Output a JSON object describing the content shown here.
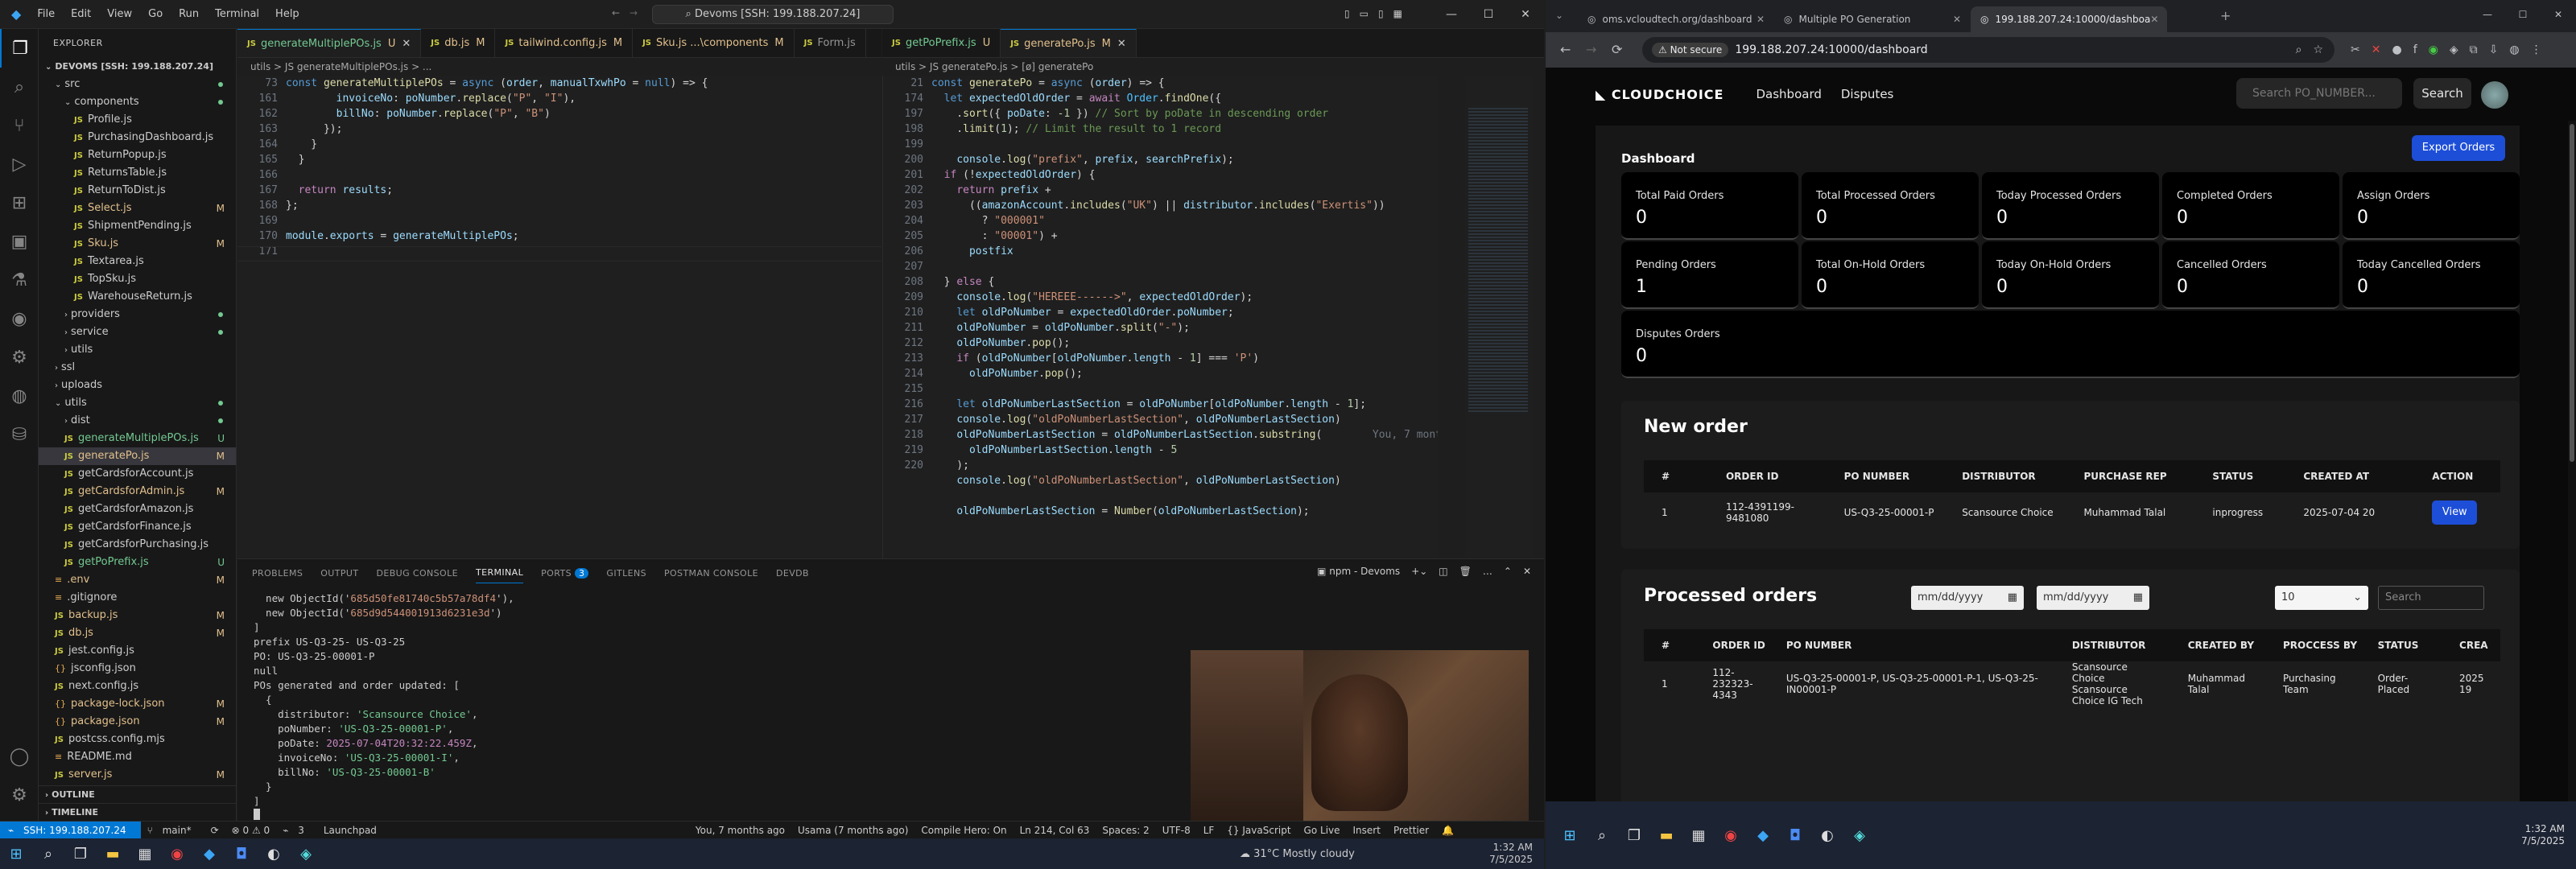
{
  "vscode": {
    "menu": [
      "File",
      "Edit",
      "View",
      "Go",
      "Run",
      "Terminal",
      "Help"
    ],
    "command_center": "Devoms [SSH: 199.188.207.24]",
    "explorer_label": "EXPLORER",
    "root": "DEVOMS [SSH: 199.188.207.24]",
    "tree": [
      {
        "label": "src",
        "kind": "folder",
        "indent": 1,
        "badge": "dot"
      },
      {
        "label": "components",
        "kind": "folder",
        "indent": 2,
        "badge": "dot"
      },
      {
        "label": "Profile.js",
        "kind": "js",
        "indent": 3,
        "badge": ""
      },
      {
        "label": "PurchasingDashboard.js",
        "kind": "js",
        "indent": 3,
        "badge": ""
      },
      {
        "label": "ReturnPopup.js",
        "kind": "js",
        "indent": 3,
        "badge": ""
      },
      {
        "label": "ReturnsTable.js",
        "kind": "js",
        "indent": 3,
        "badge": ""
      },
      {
        "label": "ReturnToDist.js",
        "kind": "js",
        "indent": 3,
        "badge": ""
      },
      {
        "label": "Select.js",
        "kind": "js",
        "indent": 3,
        "badge": "M"
      },
      {
        "label": "ShipmentPending.js",
        "kind": "js",
        "indent": 3,
        "badge": ""
      },
      {
        "label": "Sku.js",
        "kind": "js",
        "indent": 3,
        "badge": "M"
      },
      {
        "label": "Textarea.js",
        "kind": "js",
        "indent": 3,
        "badge": ""
      },
      {
        "label": "TopSku.js",
        "kind": "js",
        "indent": 3,
        "badge": ""
      },
      {
        "label": "WarehouseReturn.js",
        "kind": "js",
        "indent": 3,
        "badge": ""
      },
      {
        "label": "providers",
        "kind": "folderc",
        "indent": 2,
        "badge": "dot"
      },
      {
        "label": "service",
        "kind": "folderc",
        "indent": 2,
        "badge": "dot"
      },
      {
        "label": "utils",
        "kind": "folderc",
        "indent": 2,
        "badge": ""
      },
      {
        "label": "ssl",
        "kind": "folderc",
        "indent": 1,
        "badge": ""
      },
      {
        "label": "uploads",
        "kind": "folderc",
        "indent": 1,
        "badge": ""
      },
      {
        "label": "utils",
        "kind": "folder",
        "indent": 1,
        "badge": "dot"
      },
      {
        "label": "dist",
        "kind": "folderc",
        "indent": 2,
        "badge": "dot"
      },
      {
        "label": "generateMultiplePOs.js",
        "kind": "js",
        "indent": 2,
        "badge": "U"
      },
      {
        "label": "generatePo.js",
        "kind": "js",
        "indent": 2,
        "badge": "M",
        "selected": true
      },
      {
        "label": "getCardsforAccount.js",
        "kind": "js",
        "indent": 2,
        "badge": ""
      },
      {
        "label": "getCardsforAdmin.js",
        "kind": "js",
        "indent": 2,
        "badge": "M"
      },
      {
        "label": "getCardsforAmazon.js",
        "kind": "js",
        "indent": 2,
        "badge": ""
      },
      {
        "label": "getCardsforFinance.js",
        "kind": "js",
        "indent": 2,
        "badge": ""
      },
      {
        "label": "getCardsforPurchasing.js",
        "kind": "js",
        "indent": 2,
        "badge": ""
      },
      {
        "label": "getPoPrefix.js",
        "kind": "js",
        "indent": 2,
        "badge": "U"
      },
      {
        "label": ".env",
        "kind": "file",
        "indent": 1,
        "badge": "M"
      },
      {
        "label": ".gitignore",
        "kind": "file",
        "indent": 1,
        "badge": ""
      },
      {
        "label": "backup.js",
        "kind": "js",
        "indent": 1,
        "badge": "M"
      },
      {
        "label": "db.js",
        "kind": "js",
        "indent": 1,
        "badge": "M"
      },
      {
        "label": "jest.config.js",
        "kind": "js",
        "indent": 1,
        "badge": ""
      },
      {
        "label": "jsconfig.json",
        "kind": "json",
        "indent": 1,
        "badge": ""
      },
      {
        "label": "next.config.js",
        "kind": "js",
        "indent": 1,
        "badge": ""
      },
      {
        "label": "package-lock.json",
        "kind": "json",
        "indent": 1,
        "badge": "M"
      },
      {
        "label": "package.json",
        "kind": "json",
        "indent": 1,
        "badge": "M"
      },
      {
        "label": "postcss.config.mjs",
        "kind": "js",
        "indent": 1,
        "badge": ""
      },
      {
        "label": "README.md",
        "kind": "file",
        "indent": 1,
        "badge": ""
      },
      {
        "label": "server.js",
        "kind": "js",
        "indent": 1,
        "badge": "M"
      }
    ],
    "outline": "OUTLINE",
    "timeline": "TIMELINE",
    "tabs_left": [
      {
        "label": "generateMultiplePOs.js",
        "mark": "U",
        "active": true
      },
      {
        "label": "db.js",
        "mark": "M"
      },
      {
        "label": "tailwind.config.js",
        "mark": "M"
      },
      {
        "label": "Sku.js ...\\components",
        "mark": "M"
      },
      {
        "label": "Form.js",
        "mark": ""
      }
    ],
    "tabs_right": [
      {
        "label": "getPoPrefix.js",
        "mark": "U"
      },
      {
        "label": "generatePo.js",
        "mark": "M",
        "active": true
      }
    ],
    "breadcrumb_left": "utils > JS generateMultiplePOs.js > ...",
    "breadcrumb_right": "utils > JS generatePo.js > [ø] generatePo",
    "left_lines": [
      "73",
      "161",
      "162",
      "163",
      "164",
      "165",
      "166",
      "167",
      "168",
      "169",
      "170",
      "171"
    ],
    "left_code": [
      "<span class='kw'>const</span> <span class='fn'>generateMultiplePOs</span> = <span class='kw'>async</span> (<span class='vr'>order</span>, <span class='vr'>manualTxwhPo</span> = <span class='kw'>null</span>) => {",
      "        <span class='vr'>invoiceNo</span>: <span class='vr'>poNumber</span>.<span class='fn'>replace</span>(<span class='st'>\"P\"</span>, <span class='st'>\"I\"</span>),",
      "        <span class='vr'>billNo</span>: <span class='vr'>poNumber</span>.<span class='fn'>replace</span>(<span class='st'>\"P\"</span>, <span class='st'>\"B\"</span>)",
      "      });",
      "    }",
      "  }",
      "",
      "  <span class='kp'>return</span> <span class='vr'>results</span>;",
      "};",
      "",
      "<span class='vr'>module</span>.<span class='vr'>exports</span> = <span class='vr'>generateMultiplePOs</span>;",
      ""
    ],
    "right_lines": [
      "21",
      "174",
      "",
      "197",
      "198",
      "199",
      "200",
      "201",
      "202",
      "203",
      "204",
      "205",
      "206",
      "207",
      "208",
      "209",
      "210",
      "211",
      "212",
      "213",
      "214",
      "215",
      "216",
      "217",
      "218",
      "219",
      "220"
    ],
    "right_code": [
      "<span class='kw'>const</span> <span class='fn'>generatePo</span> = <span class='kw'>async</span> (<span class='vr'>order</span>) => {",
      "  <span class='kw'>let</span> <span class='vr'>expectedOldOrder</span> = <span class='kp'>await</span> <span class='ct'>Order</span>.<span class='fn'>findOne</span>({",
      "    .<span class='fn'>sort</span>({ <span class='vr'>poDate</span>: <span class='nm'>-1</span> }) <span class='cm'>// Sort by poDate in descending order</span>",
      "    .<span class='fn'>limit</span>(<span class='nm'>1</span>); <span class='cm'>// Limit the result to 1 record</span>",
      "",
      "    <span class='vr'>console</span>.<span class='fn'>log</span>(<span class='st'>\"prefix\"</span>, <span class='vr'>prefix</span>, <span class='vr'>searchPrefix</span>);",
      "  <span class='kp'>if</span> (!<span class='vr'>expectedOldOrder</span>) {",
      "    <span class='kp'>return</span> <span class='vr'>prefix</span> +",
      "      ((<span class='vr'>amazonAccount</span>.<span class='fn'>includes</span>(<span class='st'>\"UK\"</span>) || <span class='vr'>distributor</span>.<span class='fn'>includes</span>(<span class='st'>\"Exertis\"</span>))",
      "        ? <span class='st'>\"000001\"</span>",
      "        : <span class='st'>\"00001\"</span>) +",
      "      <span class='vr'>postfix</span>",
      "",
      "  } <span class='kp'>else</span> {",
      "    <span class='vr'>console</span>.<span class='fn'>log</span>(<span class='st'>\"HEREEE------>\"</span>, <span class='vr'>expectedOldOrder</span>);",
      "    <span class='kw'>let</span> <span class='vr'>oldPoNumber</span> = <span class='vr'>expectedOldOrder</span>.<span class='vr'>poNumber</span>;",
      "    <span class='vr'>oldPoNumber</span> = <span class='vr'>oldPoNumber</span>.<span class='fn'>split</span>(<span class='st'>\"-\"</span>);",
      "    <span class='vr'>oldPoNumber</span>.<span class='fn'>pop</span>();",
      "    <span class='kp'>if</span> (<span class='vr'>oldPoNumber</span>[<span class='vr'>oldPoNumber</span>.<span class='vr'>length</span> - <span class='nm'>1</span>] === <span class='st'>'P'</span>)",
      "      <span class='vr'>oldPoNumber</span>.<span class='fn'>pop</span>();",
      "",
      "    <span class='kw'>let</span> <span class='vr'>oldPoNumberLastSection</span> = <span class='vr'>oldPoNumber</span>[<span class='vr'>oldPoNumber</span>.<span class='vr'>length</span> - <span class='nm'>1</span>];",
      "    <span class='vr'>console</span>.<span class='fn'>log</span>(<span class='st'>\"oldPoNumberLastSection\"</span>, <span class='vr'>oldPoNumberLastSection</span>)",
      "    <span class='vr'>oldPoNumberLastSection</span> = <span class='vr'>oldPoNumberLastSection</span>.<span class='fn'>substring</span>(        <span style='color:#6e7681'>You, 7 months</span>",
      "      <span class='vr'>oldPoNumberLastSection</span>.<span class='vr'>length</span> - <span class='nm'>5</span>",
      "    );",
      "    <span class='vr'>console</span>.<span class='fn'>log</span>(<span class='st'>\"oldPoNumberLastSection\"</span>, <span class='vr'>oldPoNumberLastSection</span>)",
      "",
      "    <span class='vr'>oldPoNumberLastSection</span> = <span class='fn'>Number</span>(<span class='vr'>oldPoNumberLastSection</span>);"
    ],
    "panel_tabs": [
      "PROBLEMS",
      "OUTPUT",
      "DEBUG CONSOLE",
      "TERMINAL",
      "PORTS",
      "GITLENS",
      "POSTMAN CONSOLE",
      "DEVDB"
    ],
    "ports_count": "3",
    "terminal_name": "npm - Devoms",
    "terminal": [
      "  new ObjectId('<span class='st'>685d50fe81740c5b57a78df4</span>'),",
      "  new ObjectId('<span class='st'>685d9d544001913d6231e3d</span>')",
      "]",
      "prefix US-Q3-25- US-Q3-25",
      "PO: US-Q3-25-00001-P",
      "null",
      "POs generated and order updated: [",
      "  {",
      "    distributor: <span class='st' style='color:#73c991'>'Scansource Choice'</span>,",
      "    poNumber: <span style='color:#73c991'>'US-Q3-25-00001-P'</span>,",
      "    poDate: <span style='color:#c586c0'>2025-07-04T20:32:22.459Z</span>,",
      "    invoiceNo: <span style='color:#73c991'>'US-Q3-25-00001-I'</span>,",
      "    billNo: <span style='color:#73c991'>'US-Q3-25-00001-B'</span>",
      "  }",
      "]"
    ],
    "status": {
      "remote": "SSH: 199.188.207.24",
      "branch": "main*",
      "errors": "⊗ 0 ⚠ 0",
      "ports": "3",
      "launchpad": "Launchpad",
      "blame": "You, 7 months ago",
      "author": "Usama (7 months ago)",
      "compile": "Compile Hero: On",
      "position": "Ln 214, Col 63",
      "spaces": "Spaces: 2",
      "encoding": "UTF-8",
      "eol": "LF",
      "lang": "{} JavaScript",
      "golive": "Go Live",
      "insert": "Insert",
      "prettier": "Prettier"
    },
    "weather": "31°C  Mostly cloudy",
    "clock_time": "1:32 AM",
    "clock_date": "7/5/2025"
  },
  "chrome": {
    "tabs": [
      {
        "label": "oms.vcloudtech.org/dashboard"
      },
      {
        "label": "Multiple PO Generation"
      },
      {
        "label": "199.188.207.24:10000/dashboa",
        "active": true
      }
    ],
    "security": "Not secure",
    "url": "199.188.207.24:10000/dashboard",
    "app": {
      "logo": "CLOUDCHOICE",
      "nav": [
        "Dashboard",
        "Disputes"
      ],
      "search_placeholder": "Search PO_NUMBER...",
      "search_btn": "Search",
      "dashboard_title": "Dashboard",
      "export_btn": "Export Orders",
      "cards": [
        {
          "title": "Total Paid Orders",
          "value": "0"
        },
        {
          "title": "Total Processed Orders",
          "value": "0"
        },
        {
          "title": "Today Processed Orders",
          "value": "0"
        },
        {
          "title": "Completed Orders",
          "value": "0"
        },
        {
          "title": "Assign Orders",
          "value": "0"
        },
        {
          "title": "Pending Orders",
          "value": "1"
        },
        {
          "title": "Total On-Hold Orders",
          "value": "0"
        },
        {
          "title": "Today On-Hold Orders",
          "value": "0"
        },
        {
          "title": "Cancelled Orders",
          "value": "0"
        },
        {
          "title": "Today Cancelled Orders",
          "value": "0"
        }
      ],
      "disputes_card": {
        "title": "Disputes Orders",
        "value": "0"
      },
      "new_order": {
        "title": "New order",
        "headers": [
          "#",
          "ORDER ID",
          "PO NUMBER",
          "DISTRIBUTOR",
          "PURCHASE REP",
          "STATUS",
          "CREATED AT",
          "ACTION"
        ],
        "rows": [
          [
            "1",
            "112-4391199-9481080",
            "US-Q3-25-00001-P",
            "Scansource Choice",
            "Muhammad Talal",
            "inprogress",
            "2025-07-04 20",
            "View"
          ]
        ]
      },
      "processed": {
        "title": "Processed orders",
        "date_placeholder": "mm/dd/yyyy",
        "page_size": "10",
        "search_placeholder": "Search",
        "headers": [
          "#",
          "ORDER ID",
          "PO NUMBER",
          "DISTRIBUTOR",
          "CREATED BY",
          "PROCCESS BY",
          "STATUS",
          "CREA"
        ],
        "rows": [
          [
            "1",
            "112-\n232323-\n4343",
            "US-Q3-25-00001-P, US-Q3-25-00001-P-1, US-Q3-25-IN00001-P",
            "Scansource\nChoice\nScansource\nChoice IG Tech",
            "Muhammad\nTalal",
            "Purchasing\nTeam",
            "Order-\nPlaced",
            "2025\n19"
          ]
        ]
      }
    }
  }
}
